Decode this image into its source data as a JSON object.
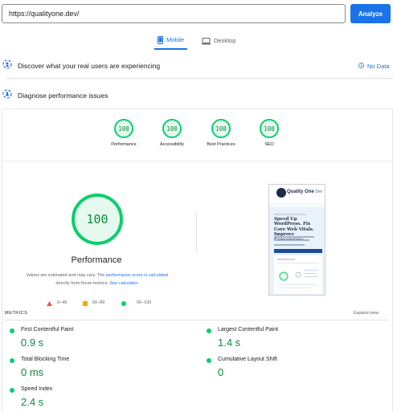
{
  "url_bar": {
    "value": "https://qualityone.dev/",
    "analyze_label": "Analyze"
  },
  "tabs": {
    "mobile": "Mobile",
    "desktop": "Desktop"
  },
  "real_users": {
    "title": "Discover what your real users are experiencing",
    "status": "No Data"
  },
  "diagnose": {
    "title": "Diagnose performance issues"
  },
  "categories": [
    {
      "label": "Performance",
      "score": "100"
    },
    {
      "label": "Accessibility",
      "score": "100"
    },
    {
      "label": "Best Practices",
      "score": "100"
    },
    {
      "label": "SEO",
      "score": "100"
    }
  ],
  "performance": {
    "score": "100",
    "title": "Performance",
    "note_prefix": "Values are estimated and may vary. The ",
    "note_link1": "performance score is calculated",
    "note_middle": "directly from these metrics. ",
    "note_link2": "See calculator."
  },
  "legend": [
    {
      "range": "0–49",
      "color": "#ff4e42"
    },
    {
      "range": "50–89",
      "color": "#ffa400"
    },
    {
      "range": "90–100",
      "color": "#0cce6b"
    }
  ],
  "screenshot": {
    "brand": "Quality One",
    "brand_suffix": "Dev",
    "headline": "Speed Up WordPress. Fix Core Web Vitals. Improve Conversions."
  },
  "metrics": {
    "label": "METRICS",
    "expand": "Expand view",
    "items": [
      {
        "name": "First Contentful Paint",
        "value": "0.9 s"
      },
      {
        "name": "Largest Contentful Paint",
        "value": "1.4 s"
      },
      {
        "name": "Total Blocking Time",
        "value": "0 ms"
      },
      {
        "name": "Cumulative Layout Shift",
        "value": "0"
      },
      {
        "name": "Speed Index",
        "value": "2.4 s"
      }
    ]
  },
  "colors": {
    "accent": "#1a73e8",
    "pass": "#0cce6b",
    "pass_text": "#0c8a3e"
  }
}
